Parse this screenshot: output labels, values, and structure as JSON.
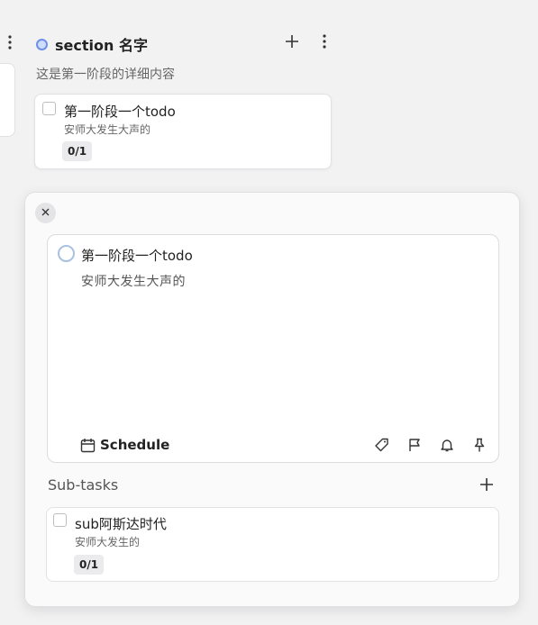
{
  "left_column": {
    "more_icon": "vertical-dots-icon"
  },
  "section": {
    "title": "section 名字",
    "description": "这是第一阶段的详细内容",
    "add_icon": "plus-icon",
    "more_icon": "vertical-dots-icon",
    "accent": "#6f8fe8",
    "card": {
      "title": "第一阶段一个todo",
      "note": "安师大发生大声的",
      "progress": "0/1"
    }
  },
  "detail": {
    "close_icon": "close-icon",
    "task": {
      "title": "第一阶段一个todo",
      "note": "安师大发生大声的"
    },
    "schedule_label": "Schedule",
    "toolbar_icons": [
      "tag-icon",
      "flag-icon",
      "bell-icon",
      "pin-icon"
    ],
    "subtasks_label": "Sub-tasks",
    "subtasks": [
      {
        "title": "sub阿斯达时代",
        "note": "安师大发生的",
        "progress": "0/1"
      }
    ]
  }
}
